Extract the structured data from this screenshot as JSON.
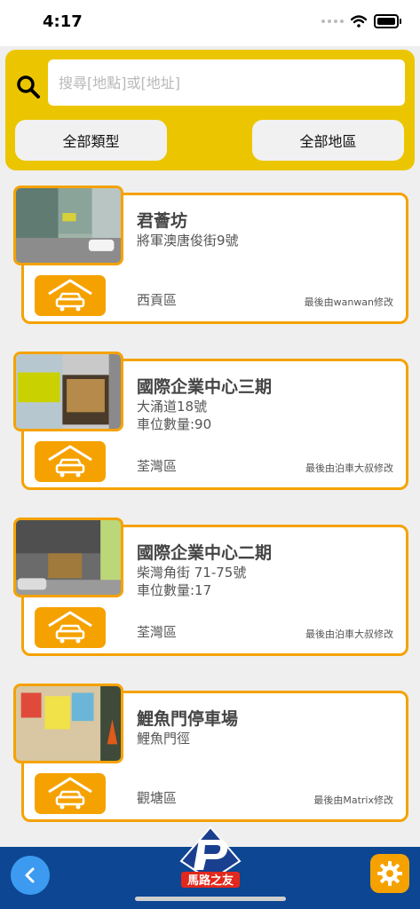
{
  "status_bar": {
    "time": "4:17"
  },
  "search": {
    "placeholder": "搜尋[地點]或[地址]",
    "value": ""
  },
  "filters": {
    "type_label": "全部類型",
    "region_label": "全部地區"
  },
  "carparks": [
    {
      "name": "君薈坊",
      "address": "將軍澳唐俊街9號",
      "spaces": "",
      "district": "西貢區",
      "last_edited": "最後由wanwan修改",
      "icon": "car-park-icon"
    },
    {
      "name": "國際企業中心三期",
      "address": "大涌道18號",
      "spaces": "車位數量:90",
      "district": "荃灣區",
      "last_edited": "最後由泊車大叔修改",
      "icon": "car-park-icon"
    },
    {
      "name": "國際企業中心二期",
      "address": "柴灣角街 71-75號",
      "spaces": "車位數量:17",
      "district": "荃灣區",
      "last_edited": "最後由泊車大叔修改",
      "icon": "car-park-icon"
    },
    {
      "name": "鯉魚門停車場",
      "address": "鯉魚門徑",
      "spaces": "",
      "district": "觀塘區",
      "last_edited": "最後由Matrix修改",
      "icon": "car-park-icon"
    }
  ],
  "bottom_bar": {
    "back_icon": "back-arrow-icon",
    "logo_text": "馬路之友",
    "settings_icon": "gear-icon"
  },
  "colors": {
    "header": "#ebc600",
    "accent": "#f5a200",
    "bottom_bar": "#0d4693",
    "back_button": "#3c9bf0"
  }
}
